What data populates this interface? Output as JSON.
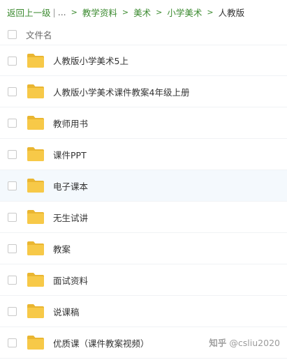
{
  "breadcrumb": {
    "back": "返回上一级",
    "pipe": "|",
    "ellipsis": "...",
    "items": [
      "教学资料",
      "美术",
      "小学美术"
    ],
    "current": "人教版",
    "separator": ">"
  },
  "header": {
    "column_label": "文件名"
  },
  "files": [
    {
      "name": "人教版小学美术5上",
      "type": "folder"
    },
    {
      "name": "人教版小学美术课件教案4年级上册",
      "type": "folder"
    },
    {
      "name": "教师用书",
      "type": "folder"
    },
    {
      "name": "课件PPT",
      "type": "folder"
    },
    {
      "name": "电子课本",
      "type": "folder"
    },
    {
      "name": "无生试讲",
      "type": "folder"
    },
    {
      "name": "教案",
      "type": "folder"
    },
    {
      "name": "面试资料",
      "type": "folder"
    },
    {
      "name": "说课稿",
      "type": "folder"
    },
    {
      "name": "优质课（课件教案视频）",
      "type": "folder"
    }
  ],
  "watermark": {
    "logo": "知乎",
    "text": "@csliu2020"
  },
  "colors": {
    "link": "#3b8a2f",
    "folder": "#f7c948",
    "folder_dark": "#eab631",
    "hover_row": "#f4f9fd"
  },
  "icons": {
    "folder": "folder-icon",
    "checkbox": "checkbox"
  }
}
